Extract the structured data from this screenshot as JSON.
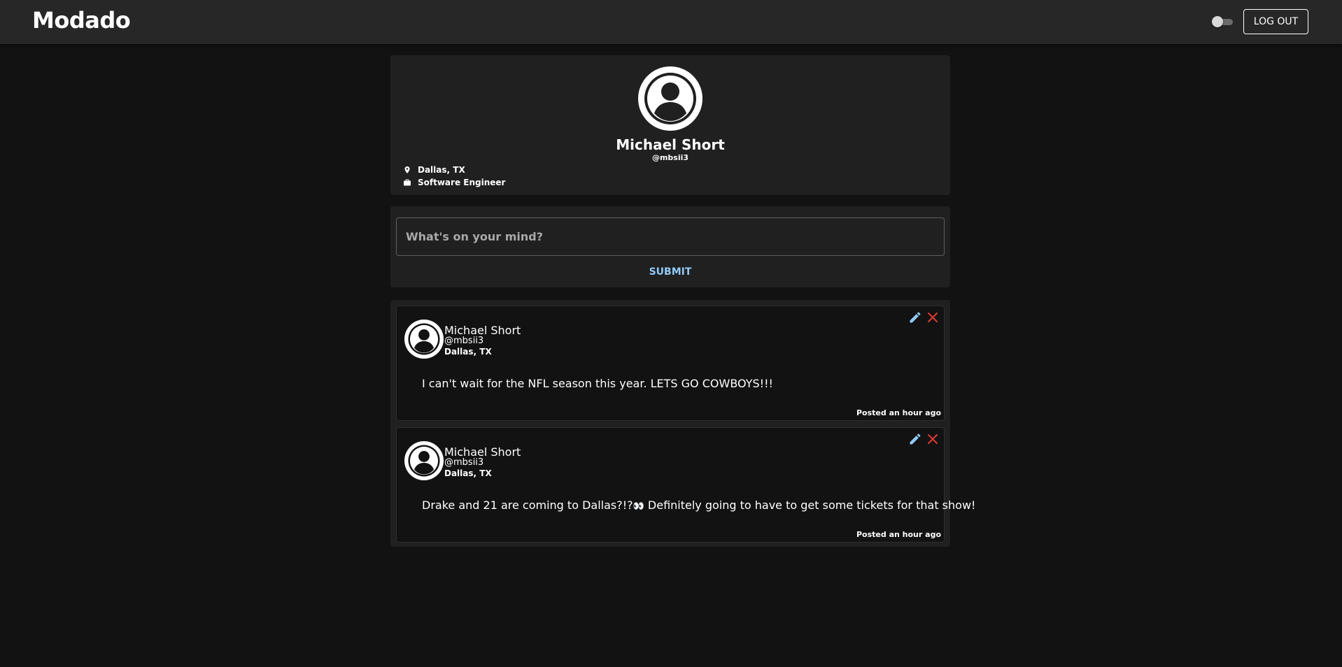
{
  "app": {
    "brand": "Modado"
  },
  "header": {
    "logout_label": "LOG OUT"
  },
  "profile": {
    "name": "Michael Short",
    "handle": "@mbsii3",
    "location": "Dallas, TX",
    "occupation": "Software Engineer"
  },
  "composer": {
    "placeholder": "What's on your mind?",
    "submit_label": "SUBMIT"
  },
  "posts": [
    {
      "name": "Michael Short",
      "handle": "@mbsii3",
      "location": "Dallas, TX",
      "body": "I can't wait for the NFL season this year. LETS GO COWBOYS!!!",
      "time": "Posted an hour ago"
    },
    {
      "name": "Michael Short",
      "handle": "@mbsii3",
      "location": "Dallas, TX",
      "body_before": "Drake and 21 are coming to Dallas?!?",
      "body_emoji": "👀",
      "body_after": " Definitely going to have to get some tickets for that show!",
      "time": "Posted an hour ago"
    }
  ],
  "colors": {
    "background": "#121212",
    "surface": "#202020",
    "topbar": "#272727",
    "accent": "#90caf9",
    "delete": "#e53935"
  },
  "icons": {
    "location": "map-pin-icon",
    "occupation": "briefcase-icon",
    "edit": "pencil-icon",
    "delete": "close-icon",
    "avatar": "account-circle-icon"
  }
}
